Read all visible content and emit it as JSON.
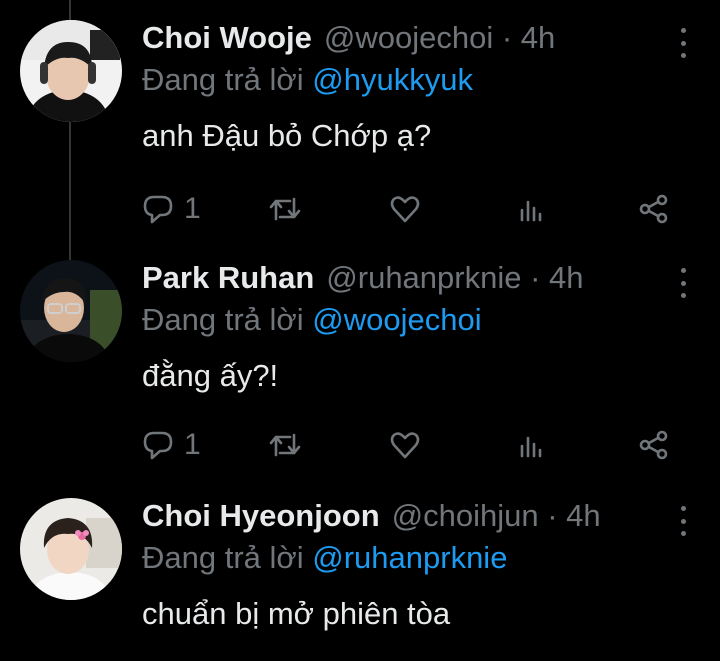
{
  "colors": {
    "background": "#000000",
    "text": "#e7e9ea",
    "muted": "#71767b",
    "accent": "#1d9bf0"
  },
  "reply_prefix": "Đang trả lời",
  "tweets": [
    {
      "name": "Choi Wooje",
      "handle": "@woojechoi · 4h",
      "reply_to": "@hyukkyuk",
      "text": "anh Đậu bỏ Chớp ạ?",
      "reply_count": "1",
      "icons": [
        "reply-icon",
        "retweet-icon",
        "like-icon",
        "analytics-icon",
        "share-icon"
      ]
    },
    {
      "name": "Park Ruhan",
      "handle": "@ruhanprknie · 4h",
      "reply_to": "@woojechoi",
      "text": "đằng ấy?!",
      "reply_count": "1",
      "icons": [
        "reply-icon",
        "retweet-icon",
        "like-icon",
        "analytics-icon",
        "share-icon"
      ]
    },
    {
      "name": "Choi Hyeonjoon",
      "handle": "@choihjun · 4h",
      "reply_to": "@ruhanprknie",
      "text": "chuẩn bị mở phiên tòa"
    }
  ]
}
